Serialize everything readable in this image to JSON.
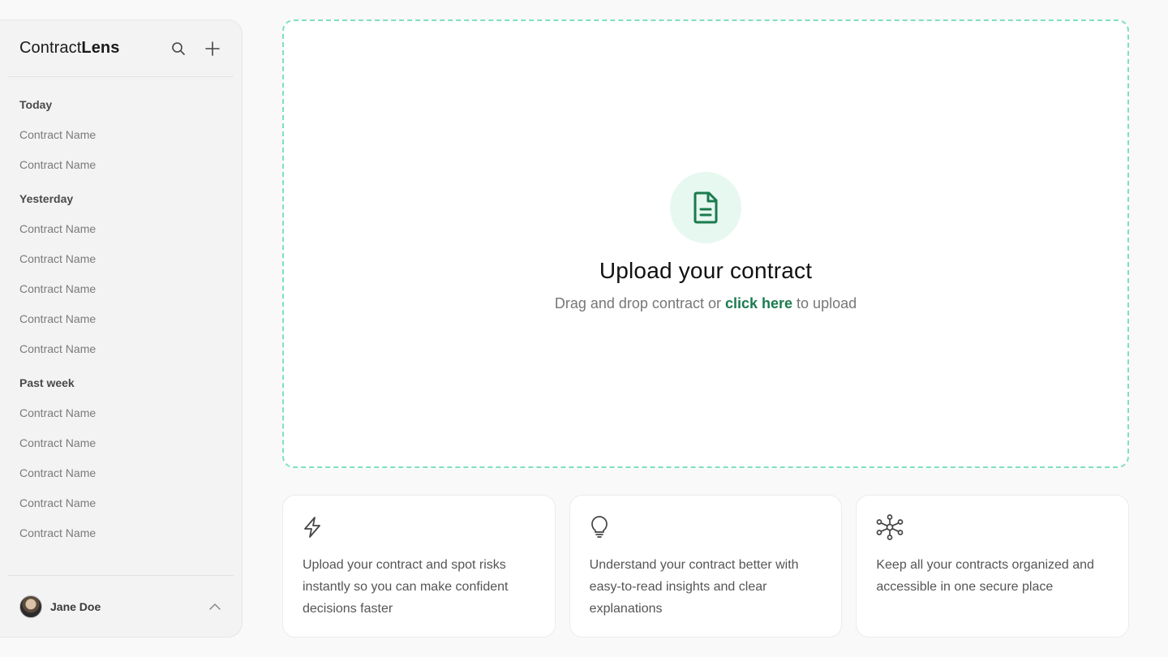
{
  "app": {
    "logo_regular": "Contract",
    "logo_bold": "Lens"
  },
  "sidebar": {
    "groups": [
      {
        "title": "Today",
        "items": [
          "Contract Name",
          "Contract Name"
        ]
      },
      {
        "title": "Yesterday",
        "items": [
          "Contract Name",
          "Contract Name",
          "Contract Name",
          "Contract Name",
          "Contract Name"
        ]
      },
      {
        "title": "Past week",
        "items": [
          "Contract Name",
          "Contract Name",
          "Contract Name",
          "Contract Name",
          "Contract Name"
        ]
      }
    ],
    "user": {
      "name": "Jane Doe"
    }
  },
  "upload": {
    "title": "Upload your contract",
    "sub_before": "Drag and drop contract or ",
    "sub_link": "click here",
    "sub_after": " to upload",
    "accent": "#1c7a4f",
    "border_color": "#7fe0bd"
  },
  "features": [
    {
      "icon": "lightning-icon",
      "text": "Upload your contract and spot risks instantly so you can make confident decisions faster"
    },
    {
      "icon": "lightbulb-icon",
      "text": "Understand your contract better with easy-to-read insights and clear explanations"
    },
    {
      "icon": "network-icon",
      "text": "Keep all your contracts organized and accessible in one secure place"
    }
  ]
}
